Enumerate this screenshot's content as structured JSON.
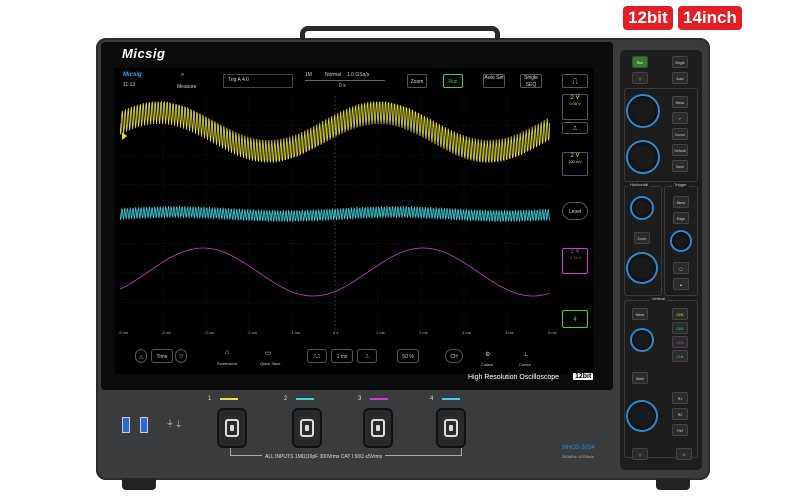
{
  "badges": {
    "bits": "12bit",
    "size": "14inch"
  },
  "brand": {
    "logo": "Micsig"
  },
  "screen": {
    "app_logo": "Micsig",
    "time": "11:13",
    "measure_label": "Measure",
    "trigger_info": "Trig A  4.0",
    "timebase": "1M",
    "mode": "Normal",
    "samplerate": "1.0 GSa/s",
    "offset": "0 s",
    "zoom": "Zoom",
    "run": "Run",
    "autoset": "Auto Set",
    "single": "Single SEQ",
    "ch_labels": [
      {
        "value": "2 V",
        "detail": "0.00 V",
        "color": "#e8e13a"
      },
      {
        "value": "2 V",
        "detail": "100 mV",
        "color": "#e8e13a"
      },
      {
        "value": "2 V",
        "detail": "-4.76 V",
        "color": "#d23ad2"
      }
    ],
    "level": "Level",
    "x_ticks": [
      "-5 ms",
      "-4 ms",
      "-3 ms",
      "-2 ms",
      "-1 ms",
      "0 s",
      "1 ms",
      "2 ms",
      "3 ms",
      "4 ms",
      "5 ms"
    ],
    "bottom_buttons": {
      "screenshot": "Screenshot",
      "quicksave": "Quick Save",
      "time": "1 ms",
      "percent": "50 %",
      "cursor": "Cursor",
      "collect": "Collect"
    },
    "hr_label": "High Resolution Oscilloscope",
    "hr_badge": "12bit"
  },
  "controls": {
    "top_buttons": [
      "Run",
      "Single",
      "",
      "Auto"
    ],
    "side_buttons": [
      "Menu",
      "",
      "Cursor",
      "Default",
      "Save"
    ],
    "horizontal": "Horizontal",
    "trigger": "Trigger",
    "h_buttons": [
      "Position",
      "Zoom",
      "Scale"
    ],
    "t_buttons": [
      "Menu",
      "Edge",
      "Level"
    ],
    "vertical": "Vertical",
    "v_buttons": [
      "Menu",
      "Position",
      "Math",
      "Scale"
    ],
    "channels": [
      "CH1",
      "CH2",
      "CH3",
      "CH4",
      "R1",
      "R2",
      "Ref"
    ]
  },
  "panel": {
    "channels": [
      "1",
      "2",
      "3",
      "4"
    ],
    "channel_colors": [
      "#e8e13a",
      "#3ad6e0",
      "#d23ad2",
      "#3ad6e0"
    ],
    "spec": "ALL INPUTS 1MΩ|16pF 300Vrms CAT I    50Ω ≤5Vrms",
    "model": "MHO3-3034",
    "model_sub": "350MHz  10GSa/s"
  }
}
